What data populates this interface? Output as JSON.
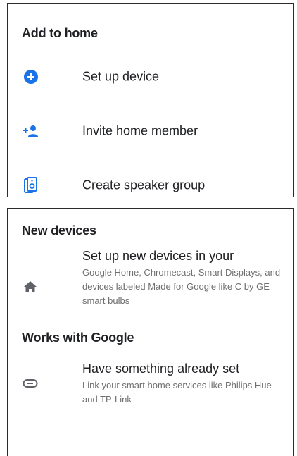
{
  "add_to_home": {
    "title": "Add to home",
    "items": [
      {
        "label": "Set up device",
        "icon": "add-circle-icon"
      },
      {
        "label": "Invite home member",
        "icon": "person-add-icon"
      },
      {
        "label": "Create speaker group",
        "icon": "speaker-group-icon"
      }
    ]
  },
  "new_devices": {
    "title": "New devices",
    "item": {
      "title": "Set up new devices in your",
      "description": "Google Home, Chromecast, Smart Displays, and devices labeled Made for Google like C by GE smart bulbs",
      "icon": "home-icon"
    }
  },
  "works_with_google": {
    "title": "Works with Google",
    "item": {
      "title": "Have something already set",
      "description": "Link your smart home services like Philips Hue and TP-Link",
      "icon": "link-icon"
    }
  },
  "colors": {
    "accent": "#1a73e8",
    "icon_gray": "#5f6368",
    "text_primary": "#202124",
    "text_secondary": "#6f6f6f"
  }
}
